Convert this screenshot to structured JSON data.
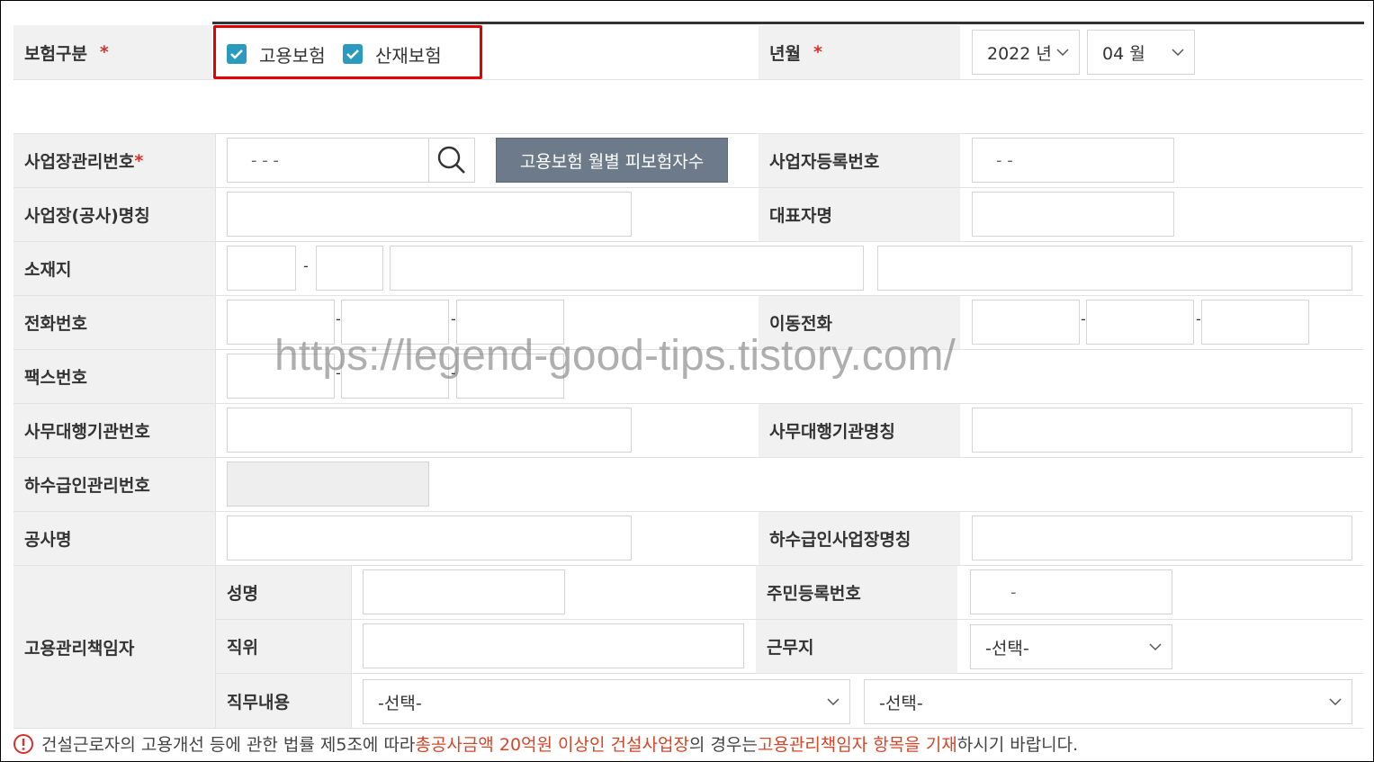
{
  "insurance_type": {
    "label": "보험구분",
    "required_mark": "*",
    "options": [
      {
        "label": "고용보험",
        "checked": true
      },
      {
        "label": "산재보험",
        "checked": true
      }
    ]
  },
  "year_month": {
    "label": "년월",
    "required_mark": "*",
    "year": "2022 년",
    "month": "04 월"
  },
  "workplace_no": {
    "label": "사업장관리번호",
    "required_mark": "*",
    "value": "- -    -"
  },
  "monthly_button": "고용보험 월별 피보험자수",
  "biz_reg_no": {
    "label": "사업자등록번호",
    "value": "- -"
  },
  "workplace_name": {
    "label": "사업장(공사)명칭"
  },
  "representative": {
    "label": "대표자명"
  },
  "location": {
    "label": "소재지",
    "dash": "-"
  },
  "phone": {
    "label": "전화번호",
    "dash": "-"
  },
  "mobile": {
    "label": "이동전화",
    "dash": "-"
  },
  "fax": {
    "label": "팩스번호",
    "dash": "-"
  },
  "agency_no": {
    "label": "사무대행기관번호"
  },
  "agency_name": {
    "label": "사무대행기관명칭"
  },
  "subcontractor_no": {
    "label": "하수급인관리번호"
  },
  "construction_name": {
    "label": "공사명"
  },
  "subcontractor_site": {
    "label": "하수급인사업장명칭"
  },
  "manager": {
    "label": "고용관리책임자",
    "name_label": "성명",
    "rrn_label": "주민등록번호",
    "rrn_value": "-",
    "position_label": "직위",
    "workplace_label": "근무지",
    "workplace_select": "-선택-",
    "duty_label": "직무내용",
    "duty_select_1": "-선택-",
    "duty_select_2": "-선택-"
  },
  "watermark": "https://legend-good-tips.tistory.com/",
  "notice": {
    "part1": "건설근로자의 고용개선 등에 관한 법률 제5조에 따라 ",
    "highlight1": "총공사금액 20억원 이상인 건설사업장",
    "part2": "의 경우는 ",
    "highlight2": "고용관리책임자 항목을 기재",
    "part3": "하시기 바랍니다."
  },
  "colors": {
    "checkbox": "#2a9bbf",
    "required": "#d9302c",
    "highlight_box": "#e50000",
    "button": "#6c7a89",
    "notice_highlight": "#d3462a"
  }
}
